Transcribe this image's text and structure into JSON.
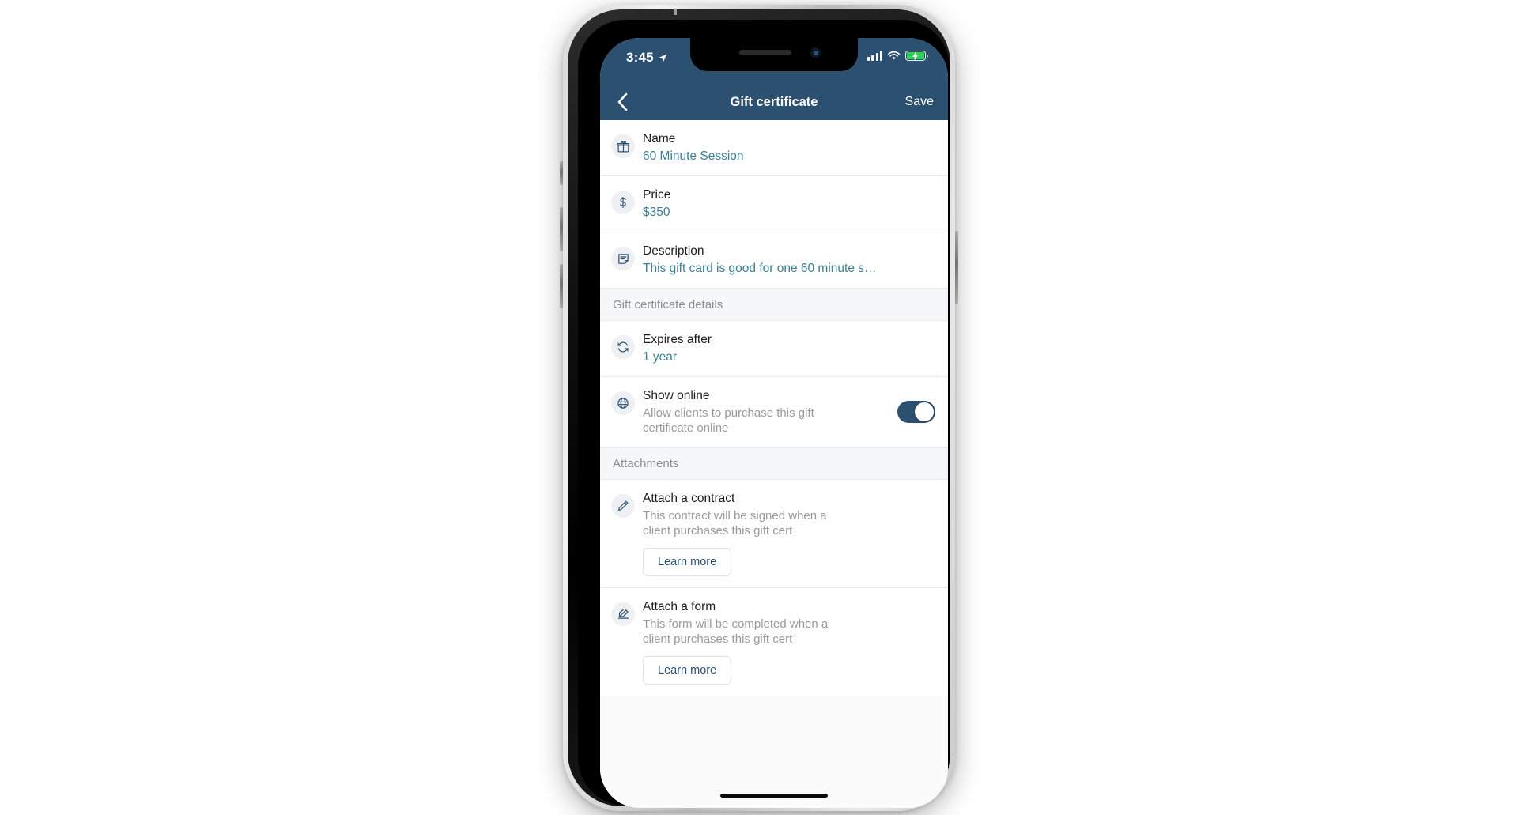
{
  "status_bar": {
    "time": "3:45",
    "location_icon": "location-arrow-icon",
    "signal_icon": "cellular-signal-icon",
    "wifi_icon": "wifi-icon",
    "battery_icon": "battery-charging-icon",
    "accent": "#2c5070"
  },
  "nav": {
    "back_icon": "chevron-left-icon",
    "title": "Gift certificate",
    "save_label": "Save"
  },
  "rows": [
    {
      "icon": "gift-icon",
      "label": "Name",
      "value": "60 Minute Session"
    },
    {
      "icon": "dollar-icon",
      "label": "Price",
      "value": "$350"
    },
    {
      "icon": "note-icon",
      "label": "Description",
      "value": "This gift card is good for one 60 minute s…"
    }
  ],
  "section_details": {
    "header": "Gift certificate details",
    "expires": {
      "icon": "refresh-icon",
      "label": "Expires after",
      "value": "1 year"
    },
    "show_online": {
      "icon": "globe-icon",
      "label": "Show online",
      "description": "Allow clients to purchase this gift certificate online",
      "toggle_on": true,
      "toggle_color": "#2c5070"
    }
  },
  "section_attachments": {
    "header": "Attachments",
    "items": [
      {
        "icon": "pen-icon",
        "label": "Attach a contract",
        "description": "This contract will be signed when a client purchases this gift cert",
        "button": "Learn more"
      },
      {
        "icon": "sign-document-icon",
        "label": "Attach a form",
        "description": "This form will be completed when a client purchases this gift cert",
        "button": "Learn more"
      }
    ]
  },
  "colors": {
    "header_blue": "#2c5070",
    "value_teal": "#3b7f92",
    "muted_gray": "#9a9a9e"
  }
}
